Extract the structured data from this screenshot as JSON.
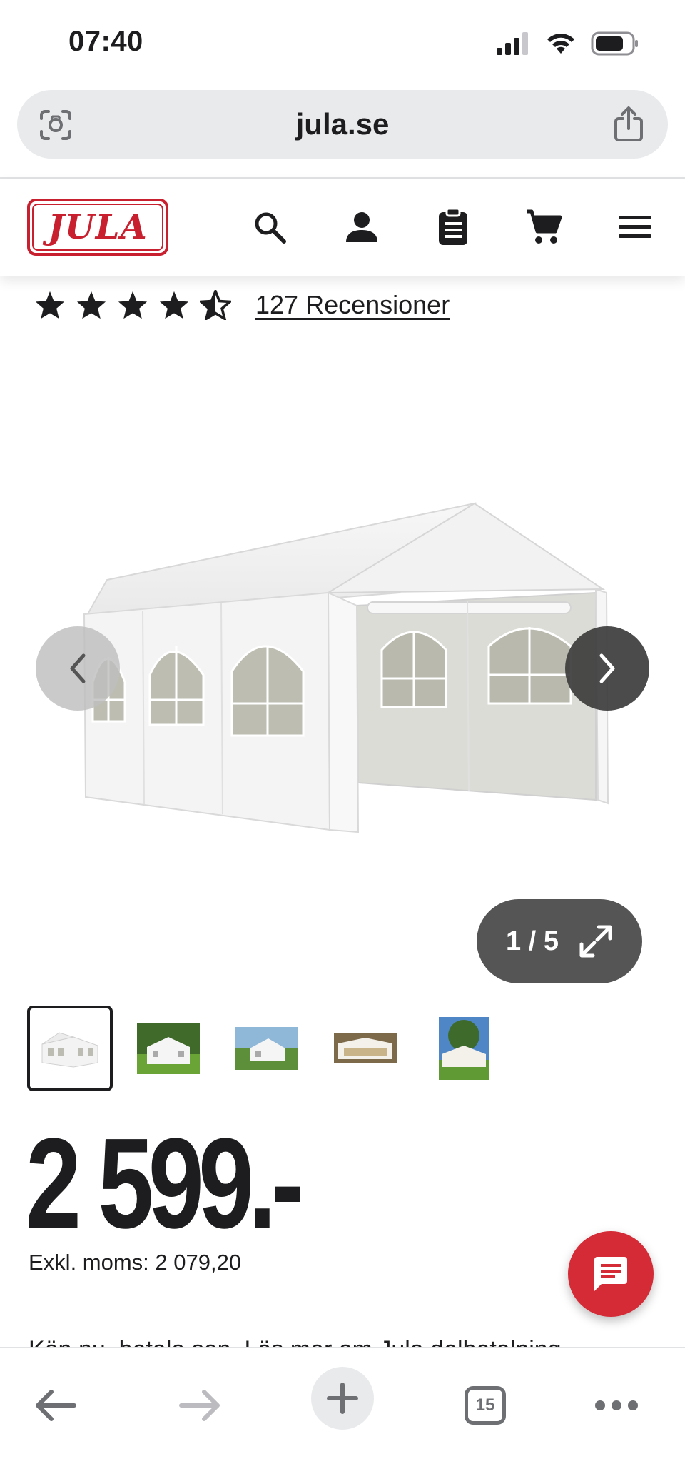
{
  "status_bar": {
    "time": "07:40",
    "icons": [
      "signal-icon",
      "wifi-icon",
      "battery-icon"
    ]
  },
  "browser": {
    "url": "jula.se",
    "left_icon": "visual-lookup-icon",
    "right_icon": "share-icon"
  },
  "site_header": {
    "logo_text": "JULA",
    "brand_color": "#c8202f",
    "icons": [
      "search-icon",
      "account-icon",
      "list-icon",
      "cart-icon",
      "menu-icon"
    ]
  },
  "rating": {
    "stars": 4.5,
    "max_stars": 5,
    "reviews_label": "127 Recensioner"
  },
  "gallery": {
    "current_image": 1,
    "total_images": 5,
    "counter_label": "1 / 5",
    "thumbnails": [
      "thumbnail-1",
      "thumbnail-2",
      "thumbnail-3",
      "thumbnail-4",
      "thumbnail-5"
    ],
    "selected_thumbnail": 1
  },
  "price": {
    "value": "2 599.-",
    "exkl_moms": "Exkl. moms: 2 079,20"
  },
  "promo": {
    "text": "Köp nu, betala sen. Läs mer om Jula delbetalning"
  },
  "chat": {
    "accent": "#d42b36"
  },
  "bottom_toolbar": {
    "tabs_count": "15",
    "items": [
      "back-icon",
      "forward-icon",
      "new-tab-icon",
      "tabs-icon",
      "more-icon"
    ]
  }
}
